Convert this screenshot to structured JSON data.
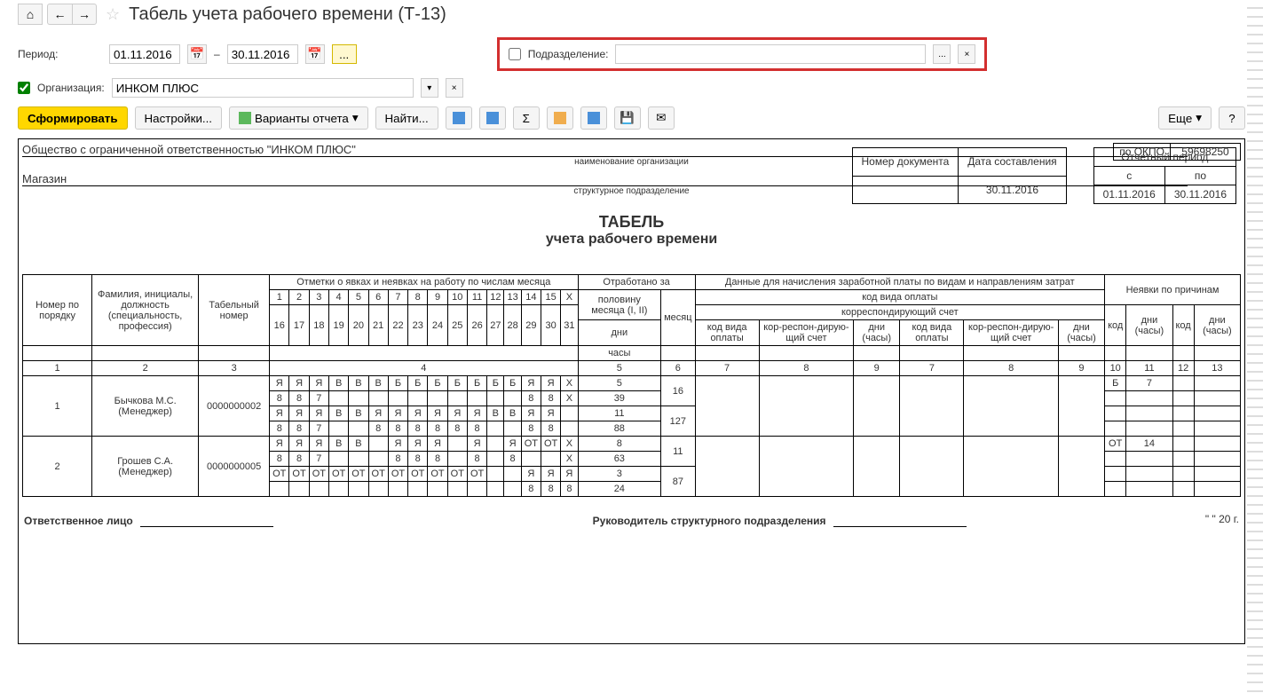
{
  "title": "Табель учета рабочего времени (Т-13)",
  "period_label": "Период:",
  "date_from": "01.11.2016",
  "date_to": "30.11.2016",
  "dash": "–",
  "dept_label": "Подразделение:",
  "org_label": "Организация:",
  "org_value": "ИНКОМ ПЛЮС",
  "toolbar": {
    "generate": "Сформировать",
    "settings": "Настройки...",
    "variants": "Варианты отчета",
    "find": "Найти...",
    "more": "Еще",
    "help": "?"
  },
  "report": {
    "org_full": "Общество с ограниченной ответственностью \"ИНКОМ ПЛЮС\"",
    "org_sub": "наименование организации",
    "dept": "Магазин",
    "dept_sub": "структурное подразделение",
    "okpo_lbl": "по ОКПО",
    "okpo": "59698250",
    "doc_title": "ТАБЕЛЬ",
    "doc_sub": "учета  рабочего  времени",
    "meta": {
      "doc_num_h": "Номер документа",
      "doc_date_h": "Дата составления",
      "doc_num": "",
      "doc_date": "30.11.2016",
      "period_h": "Отчетный период",
      "from_h": "с",
      "to_h": "по",
      "from": "01.11.2016",
      "to": "30.11.2016"
    },
    "headers": {
      "num": "Номер по порядку",
      "fio": "Фамилия, инициалы, должность (специальность, профессия)",
      "tabnum": "Табельный номер",
      "marks": "Отметки о явках и неявках на работу по числам месяца",
      "worked": "Отработано за",
      "half": "половину месяца (I, II)",
      "month": "месяц",
      "days": "дни",
      "hours": "часы",
      "pay": "Данные для начисления заработной платы по видам и направлениям затрат",
      "paycode": "код вида оплаты",
      "corr": "корреспондирующий счет",
      "paycode_s": "код вида оплаты",
      "corr_s": "кор-респон-дирую-щий счет",
      "dayshours": "дни (часы)",
      "absence": "Неявки по причинам",
      "code": "код"
    },
    "col_nums": {
      "c1": "1",
      "c2": "2",
      "c3": "3",
      "c4": "4",
      "c5": "5",
      "c6": "6",
      "c7": "7",
      "c8": "8",
      "c9": "9",
      "c10": "10",
      "c11": "11",
      "c12": "12",
      "c13": "13"
    },
    "days1": [
      "1",
      "2",
      "3",
      "4",
      "5",
      "6",
      "7",
      "8",
      "9",
      "10",
      "11",
      "12",
      "13",
      "14",
      "15",
      "X"
    ],
    "days2": [
      "16",
      "17",
      "18",
      "19",
      "20",
      "21",
      "22",
      "23",
      "24",
      "25",
      "26",
      "27",
      "28",
      "29",
      "30",
      "31"
    ],
    "rows": [
      {
        "num": "1",
        "name": "Бычкова М.С.",
        "pos": "(Менеджер)",
        "tab": "0000000002",
        "r1": [
          "Я",
          "Я",
          "Я",
          "В",
          "В",
          "В",
          "Б",
          "Б",
          "Б",
          "Б",
          "Б",
          "Б",
          "Б",
          "Я",
          "Я",
          "X"
        ],
        "r2": [
          "8",
          "8",
          "7",
          "",
          "",
          "",
          "",
          "",
          "",
          "",
          "",
          "",
          "",
          "8",
          "8",
          "X"
        ],
        "r3": [
          "Я",
          "Я",
          "Я",
          "В",
          "В",
          "Я",
          "Я",
          "Я",
          "Я",
          "Я",
          "Я",
          "В",
          "В",
          "Я",
          "Я",
          ""
        ],
        "r4": [
          "8",
          "8",
          "7",
          "",
          "",
          "8",
          "8",
          "8",
          "8",
          "8",
          "8",
          "",
          "",
          "8",
          "8",
          ""
        ],
        "d1": "5",
        "d2": "39",
        "d3": "11",
        "d4": "88",
        "md": "16",
        "mh": "127",
        "abs_code": "Б",
        "abs_val": "7"
      },
      {
        "num": "2",
        "name": "Грошев  С.А.",
        "pos": "(Менеджер)",
        "tab": "0000000005",
        "r1": [
          "Я",
          "Я",
          "Я",
          "В",
          "В",
          "",
          "Я",
          "Я",
          "Я",
          "",
          "Я",
          "",
          "Я",
          "ОТ",
          "ОТ",
          "X"
        ],
        "r2": [
          "8",
          "8",
          "7",
          "",
          "",
          "",
          "8",
          "8",
          "8",
          "",
          "8",
          "",
          "8",
          "",
          "",
          "X"
        ],
        "r3": [
          "ОТ",
          "ОТ",
          "ОТ",
          "ОТ",
          "ОТ",
          "ОТ",
          "ОТ",
          "ОТ",
          "ОТ",
          "ОТ",
          "ОТ",
          "",
          "",
          "Я",
          "Я",
          "Я"
        ],
        "r4": [
          "",
          "",
          "",
          "",
          "",
          "",
          "",
          "",
          "",
          "",
          "",
          "",
          "",
          "8",
          "8",
          "8"
        ],
        "d1": "8",
        "d2": "63",
        "d3": "3",
        "d4": "24",
        "md": "11",
        "mh": "87",
        "abs_code": "ОТ",
        "abs_val": "14"
      }
    ],
    "footer": {
      "resp": "Ответственное лицо",
      "ruk": "Руководитель структурного подразделения",
      "date_mark": "\"    \"            20    г."
    }
  }
}
